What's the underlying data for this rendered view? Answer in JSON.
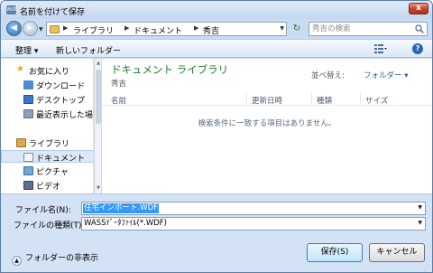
{
  "titlebar": {
    "title": "名前を付けて保存",
    "app_icon": "Wdf",
    "close_label": "x"
  },
  "nav": {
    "back_glyph": "◀",
    "forward_glyph": "▶",
    "breadcrumbs": [
      "ライブラリ",
      "ドキュメント",
      "秀吉"
    ],
    "search_placeholder": "秀吉の検索",
    "refresh_glyph": "↻"
  },
  "toolbar": {
    "organize_label": "整理 ▾",
    "new_folder_label": "新しいフォルダー"
  },
  "sidebar": {
    "favorites_label": "お気に入り",
    "favorites": [
      "ダウンロード",
      "デスクトップ",
      "最近表示した場所"
    ],
    "libraries_label": "ライブラリ",
    "libraries": [
      "ドキュメント",
      "ピクチャ",
      "ビデオ"
    ]
  },
  "content": {
    "library_title": "ドキュメント ライブラリ",
    "library_subtitle": "秀吉",
    "arrange_label": "並べ替え:",
    "arrange_value": "フォルダー ▾",
    "columns": [
      "名前",
      "更新日時",
      "種類",
      "サイズ"
    ],
    "empty_message": "検索条件に一致する項目はありません。"
  },
  "form": {
    "filename_label": "ファイル名(N):",
    "filename_value": "住宅インポート.WDF",
    "filetype_label": "ファイルの種類(T):",
    "filetype_value": "WASSﾃﾞｰﾀﾌｧｲﾙ(*.WDF)"
  },
  "footer": {
    "hide_folders_label": "フォルダーの非表示",
    "save_label": "保存(S)",
    "cancel_label": "キャンセル"
  },
  "colors": {
    "library_title": "#1e7a2e",
    "selection": "#3399ff",
    "link": "#1d5fb0"
  }
}
